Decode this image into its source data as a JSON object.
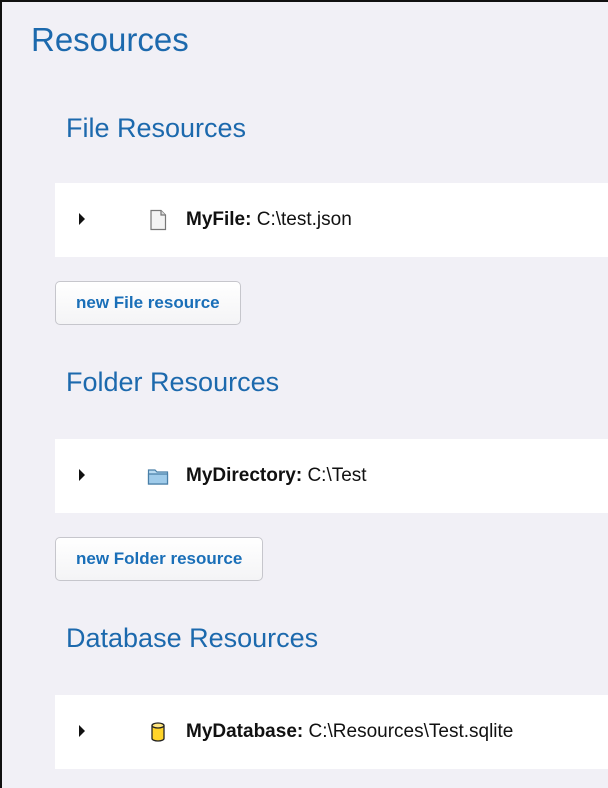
{
  "page": {
    "title": "Resources"
  },
  "sections": [
    {
      "title": "File Resources",
      "item": {
        "name": "MyFile:",
        "path": "C:\\test.json",
        "icon": "file-icon"
      },
      "button_label": "new File resource"
    },
    {
      "title": "Folder Resources",
      "item": {
        "name": "MyDirectory:",
        "path": "C:\\Test",
        "icon": "folder-icon"
      },
      "button_label": "new Folder resource"
    },
    {
      "title": "Database Resources",
      "item": {
        "name": "MyDatabase:",
        "path": "C:\\Resources\\Test.sqlite",
        "icon": "database-icon"
      }
    }
  ],
  "colors": {
    "heading": "#1c69ad",
    "button_text": "#1a6fb8",
    "panel_bg": "#f1f0f6",
    "folder_icon": "#9fcbea",
    "database_icon": "#ffd42a"
  }
}
